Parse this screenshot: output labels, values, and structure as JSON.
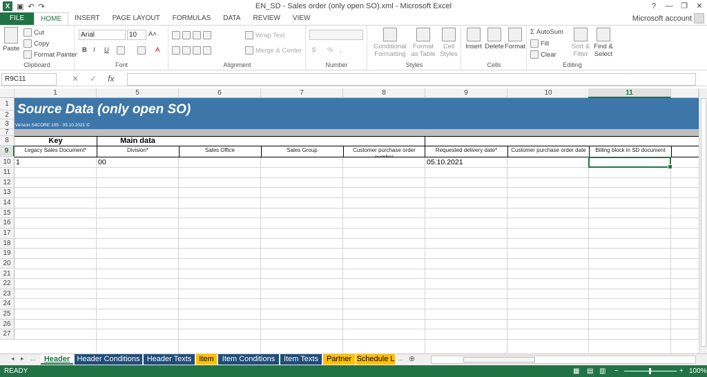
{
  "window": {
    "title": "EN_SD - Sales order (only open SO).xml - Microsoft Excel",
    "help": "?",
    "min": "—",
    "restore": "❐",
    "close": "✕"
  },
  "qat": {
    "undo": "↶",
    "redo": "↷",
    "save": "▣"
  },
  "ribbon_tabs": [
    "FILE",
    "HOME",
    "INSERT",
    "PAGE LAYOUT",
    "FORMULAS",
    "DATA",
    "REVIEW",
    "VIEW"
  ],
  "account": "Microsoft account",
  "clipboard": {
    "paste": "Paste",
    "cut": "Cut",
    "copy": "Copy",
    "format_painter": "Format Painter",
    "label": "Clipboard"
  },
  "font": {
    "name": "Arial",
    "size": "10",
    "bold": "B",
    "italic": "I",
    "underline": "U",
    "grow": "A˄",
    "shrink": "A˅",
    "color": "A",
    "label": "Font"
  },
  "alignment": {
    "wrap": "Wrap Text",
    "merge": "Merge & Center",
    "label": "Alignment"
  },
  "number": {
    "currency": "$",
    "percent": "%",
    "comma": ",",
    "label": "Number"
  },
  "styles": {
    "cond": "Conditional Formatting",
    "table": "Format as Table",
    "cell": "Cell Styles",
    "label": "Styles"
  },
  "cells": {
    "insert": "Insert",
    "delete": "Delete",
    "format": "Format",
    "label": "Cells"
  },
  "editing": {
    "autosum": "AutoSum",
    "fill": "Fill",
    "clear": "Clear",
    "sort": "Sort & Filter",
    "find": "Find & Select",
    "label": "Editing"
  },
  "formula_bar": {
    "name_box": "R9C11",
    "fx": "fx",
    "cancel": "✕",
    "enter": "✓",
    "content": ""
  },
  "columns": [
    "1",
    "5",
    "6",
    "7",
    "8",
    "9",
    "10",
    "11"
  ],
  "rows": [
    "1",
    "2",
    "3",
    "7",
    "8",
    "9",
    "10",
    "11",
    "12",
    "13",
    "14",
    "15",
    "16",
    "17",
    "18",
    "19",
    "20",
    "21",
    "22",
    "23",
    "24",
    "25",
    "26",
    "27"
  ],
  "sheet": {
    "title": "Source Data (only open SO)",
    "version": "Version S4CORE 105 - 05.10.2021 ©",
    "section_key": "Key",
    "section_main": "Main data",
    "fields": [
      "Legacy Sales Document*",
      "Division*",
      "Sales Office",
      "Sales Group",
      "Customer purchase order number",
      "Requested delivery date*",
      "Customer purchase order date",
      "Billing block in SD document"
    ],
    "row9": [
      "1",
      "00",
      "",
      "",
      "",
      "05.10.2021",
      "",
      ""
    ]
  },
  "sheet_tabs": [
    {
      "label": "Header",
      "style": "active"
    },
    {
      "label": "Header Conditions",
      "style": "dark"
    },
    {
      "label": "Header Texts",
      "style": "dark"
    },
    {
      "label": "Item",
      "style": "gold"
    },
    {
      "label": "Item Conditions",
      "style": "dark"
    },
    {
      "label": "Item Texts",
      "style": "dark"
    },
    {
      "label": "Partner",
      "style": "gold"
    },
    {
      "label": "Schedule L",
      "style": "gold"
    }
  ],
  "sheet_nav": {
    "first": "◂",
    "prev": "▸",
    "more": "...",
    "more_right": "...",
    "add": "⊕"
  },
  "status": {
    "ready": "READY",
    "zoom": "100%"
  }
}
